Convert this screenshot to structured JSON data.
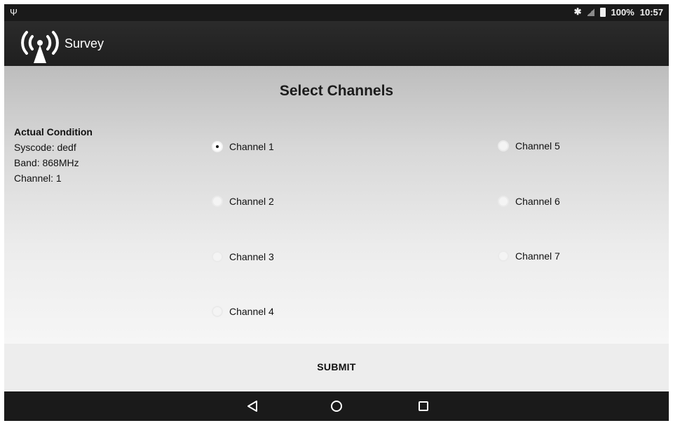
{
  "status_bar": {
    "battery_text": "100%",
    "time": "10:57",
    "icons": [
      "usb-icon",
      "bluetooth-icon",
      "signal-icon",
      "battery-icon"
    ]
  },
  "app_bar": {
    "title": "Survey",
    "logo_icon": "wireless-tower-icon"
  },
  "page": {
    "title": "Select Channels"
  },
  "condition": {
    "heading": "Actual Condition",
    "syscode": "Syscode: dedf",
    "band": "Band: 868MHz",
    "channel": "Channel: 1"
  },
  "channels": [
    {
      "label": "Channel 1",
      "selected": true
    },
    {
      "label": "Channel 2",
      "selected": false
    },
    {
      "label": "Channel 3",
      "selected": false
    },
    {
      "label": "Channel 4",
      "selected": false
    },
    {
      "label": "Channel 5",
      "selected": false
    },
    {
      "label": "Channel 6",
      "selected": false
    },
    {
      "label": "Channel 7",
      "selected": false
    }
  ],
  "submit_label": "SUBMIT",
  "nav": {
    "icons": [
      "back-icon",
      "home-icon",
      "recents-icon"
    ]
  }
}
